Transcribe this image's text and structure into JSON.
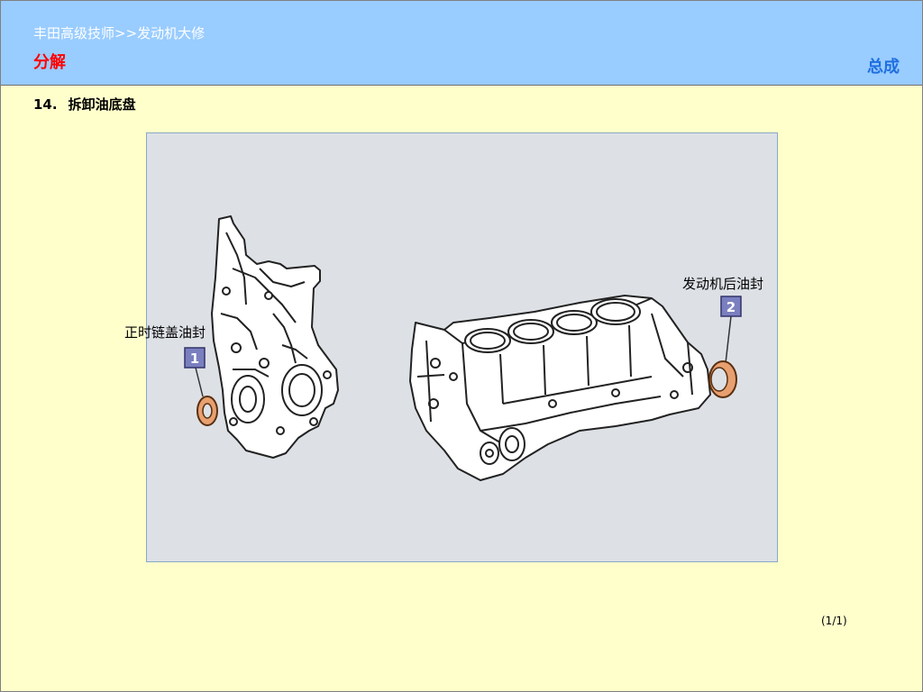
{
  "header": {
    "breadcrumb": "丰田高级技师>>发动机大修",
    "section_title": "分解",
    "assembly_link": "总成"
  },
  "step": {
    "number": "14.",
    "title": "拆卸油底盘"
  },
  "figure": {
    "callouts": [
      {
        "number": "1",
        "label": "正时链盖油封"
      },
      {
        "number": "2",
        "label": "发动机后油封"
      }
    ]
  },
  "pagination": {
    "indicator": "(1/1)"
  },
  "colors": {
    "header_bg": "#99ccff",
    "page_bg": "#ffffcc",
    "section_title": "#ff0000",
    "link": "#1f6fe0",
    "figure_bg": "#dde1e6",
    "badge": "#7a7fbf",
    "seal": "#e8a070"
  }
}
